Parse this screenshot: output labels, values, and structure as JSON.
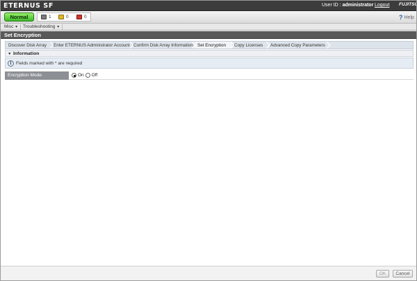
{
  "header": {
    "logo": "ETERNUS SF",
    "userid_label": "User ID :",
    "username": "administrator",
    "logout": "Logout",
    "brand": "FUJITSU"
  },
  "status": {
    "state": "Normal",
    "counts": [
      {
        "icon": "monitor-icon",
        "value": "1"
      },
      {
        "icon": "warning-icon",
        "value": "0"
      },
      {
        "icon": "error-icon",
        "value": "0"
      }
    ],
    "help": "Help"
  },
  "menu": {
    "items": [
      "Misc",
      "Troubleshooting"
    ]
  },
  "page": {
    "title": "Set Encryption"
  },
  "wizard": {
    "steps": [
      "Discover Disk Array",
      "Enter ETERNUS Administrator Account",
      "Confirm Disk Array Information",
      "Set Encryption",
      "Copy Licenses",
      "Advanced Copy Parameters"
    ],
    "current_index": 3
  },
  "information": {
    "heading": "Information",
    "note": "Fields marked with  * are required"
  },
  "form": {
    "label": "Encryption Mode:",
    "options": [
      "On",
      "Off"
    ],
    "selected": "On"
  },
  "footer": {
    "ok": "OK",
    "cancel": "Cancel"
  }
}
